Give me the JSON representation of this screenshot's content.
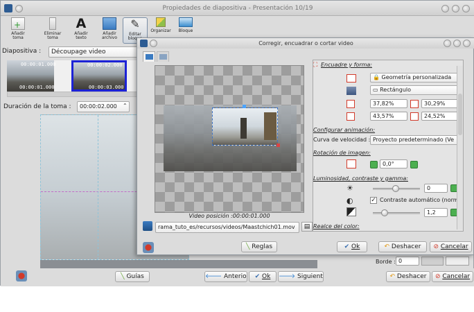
{
  "main_window": {
    "title": "Propiedades de diapositiva - Presentación 10/19",
    "toolbar": [
      {
        "label": "Añadir toma",
        "icon": "add-clip-icon"
      },
      {
        "label": "Eliminar toma",
        "icon": "delete-clip-icon"
      },
      {
        "label": "Añadir texto",
        "icon": "add-text-icon"
      },
      {
        "label": "Añadir archivo",
        "icon": "add-file-icon"
      },
      {
        "label": "Editar bloque",
        "icon": "edit-block-icon"
      },
      {
        "label": "Organizar",
        "icon": "organize-icon"
      },
      {
        "label": "Bloque",
        "icon": "block-icon"
      }
    ],
    "slide_label": "Diapositiva :",
    "slide_value": "Découpage video",
    "thumbnails": [
      {
        "time_top": "00:00:01.000",
        "time_bottom": "00:00:01.000",
        "selected": false
      },
      {
        "time_top": "00:00:02.000",
        "time_bottom": "00:00:03.000",
        "selected": true
      }
    ],
    "duration_label": "Duración de la toma :",
    "duration_value": "00:00:02.000",
    "border_label": "Borde :",
    "border_value": "0",
    "bottom_buttons": {
      "guides": "Guías",
      "previous": "Anterior",
      "ok": "Ok",
      "next": "Siguiente",
      "undo": "Deshacer",
      "cancel": "Cancelar"
    }
  },
  "dialog": {
    "title": "Corregir, encuadrar o cortar video",
    "position_label": "Video posición :00:00:01.000",
    "file_path": "rama_tuto_es/recursos/videos/Maastchich01.mov",
    "panel": {
      "framing_title": "Encuadre y forma:",
      "framing_combo": "Geometría personalizada",
      "shape_combo": "Rectángulo",
      "x_value": "37,82%",
      "w_value": "30,29%",
      "y_value": "43,57%",
      "h_value": "24,52%",
      "animation_title": "Configurar animación:",
      "speed_label": "Curva de velocidad :",
      "speed_value": "Proyecto predeterminado (Ve",
      "rotation_title": "Rotación de imagen:",
      "rotation_value": "0,0°",
      "luminosity_title": "Luminosidad, contraste y gamma:",
      "luminosity_value": "0",
      "auto_contrast_label": "Contraste automático (norm",
      "auto_contrast_checked": true,
      "gamma_value": "1,2",
      "color_title": "Realce del color:"
    },
    "buttons": {
      "rules": "Reglas",
      "ok": "Ok",
      "undo": "Deshacer",
      "cancel": "Cancelar"
    }
  },
  "colors": {
    "selection_border": "#1c22d6",
    "crop_line": "#3c73c8",
    "cancel_icon": "#d23a2a",
    "nav_blue": "#2f7fd1"
  }
}
